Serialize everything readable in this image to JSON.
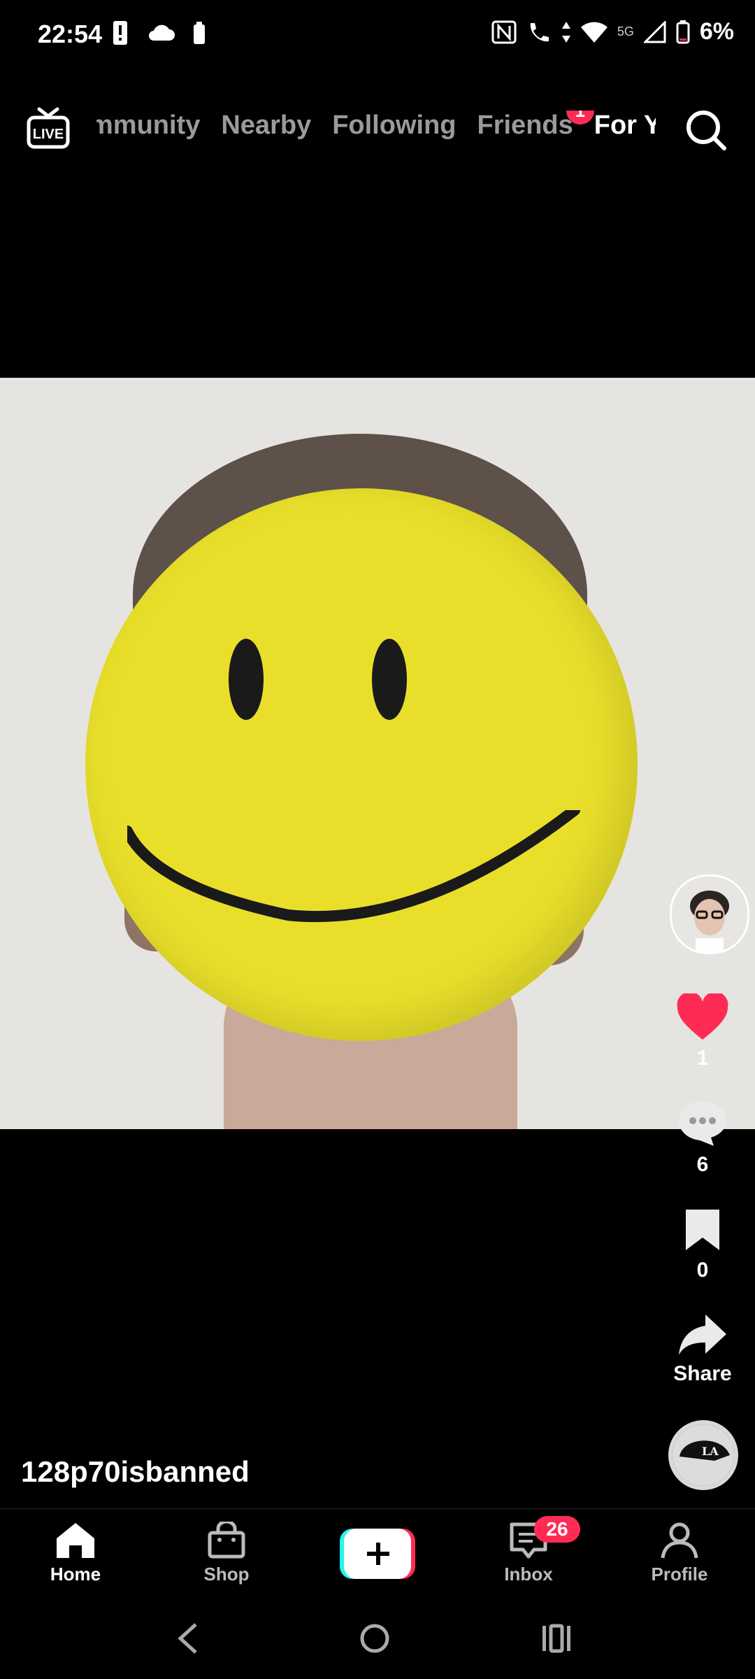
{
  "status_bar": {
    "time": "22:54",
    "battery_percent": "6%",
    "network": "5G",
    "icons": [
      "alert-icon",
      "cloud-icon",
      "battery-saver-icon",
      "nfc-icon",
      "wifi-calling-icon",
      "wifi-icon",
      "signal-icon",
      "battery-icon"
    ]
  },
  "top_nav": {
    "live_label": "LIVE",
    "tabs": [
      {
        "label": "mmunity",
        "active": false
      },
      {
        "label": "Nearby",
        "active": false
      },
      {
        "label": "Following",
        "active": false
      },
      {
        "label": "Friends",
        "active": false,
        "badge": "1"
      },
      {
        "label": "For You",
        "active": true
      }
    ]
  },
  "video": {
    "description": "Person with yellow smiley face covering their face"
  },
  "actions": {
    "likes": "1",
    "comments": "6",
    "favorites": "0",
    "share_label": "Share"
  },
  "post": {
    "username": "128p70isbanned"
  },
  "bottom_nav": {
    "items": [
      {
        "label": "Home",
        "active": true
      },
      {
        "label": "Shop",
        "active": false
      },
      {
        "label": "Inbox",
        "active": false,
        "badge": "26"
      },
      {
        "label": "Profile",
        "active": false
      }
    ]
  },
  "colors": {
    "accent": "#fe2c55",
    "smiley": "#e9df2a",
    "background": "#000000"
  }
}
